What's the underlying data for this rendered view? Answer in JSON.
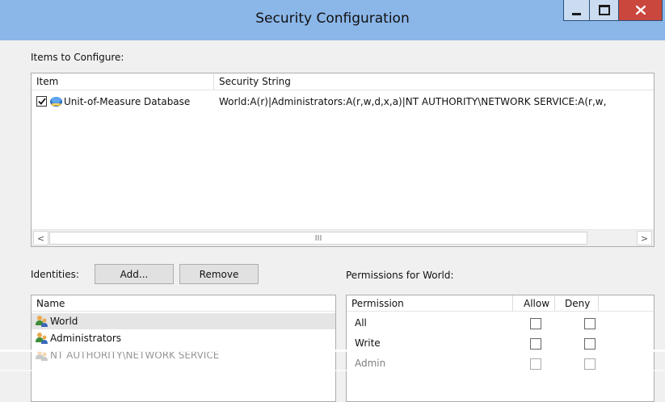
{
  "window": {
    "title": "Security Configuration",
    "controls": {
      "minimize": "minimize-icon",
      "maximize": "maximize-icon",
      "close": "close-icon"
    }
  },
  "items_section": {
    "label": "Items to Configure:",
    "columns": [
      "Item",
      "Security String"
    ],
    "rows": [
      {
        "checked": true,
        "icon": "database-icon",
        "item": "Unit-of-Measure Database",
        "security_string": "World:A(r)|Administrators:A(r,w,d,x,a)|NT AUTHORITY\\NETWORK SERVICE:A(r,w,"
      }
    ],
    "scrollbar": {
      "left_arrow": "<",
      "right_arrow": ">",
      "thumb_grip": "III"
    }
  },
  "identities": {
    "label": "Identities:",
    "add_button": "Add...",
    "remove_button": "Remove",
    "column": "Name",
    "items": [
      {
        "name": "World",
        "icon": "user-group-icon",
        "selected": true
      },
      {
        "name": "Administrators",
        "icon": "user-group-icon",
        "selected": false
      },
      {
        "name": "NT AUTHORITY\\NETWORK SERVICE",
        "icon": "user-group-icon",
        "selected": false
      }
    ]
  },
  "permissions": {
    "label": "Permissions for World:",
    "columns": [
      "Permission",
      "Allow",
      "Deny"
    ],
    "rows": [
      {
        "name": "All",
        "allow": false,
        "deny": false
      },
      {
        "name": "Write",
        "allow": false,
        "deny": false
      },
      {
        "name": "Admin",
        "allow": false,
        "deny": false
      }
    ]
  },
  "colors": {
    "titlebar": "#8bb6e8",
    "close_button": "#c9473d",
    "selection": "#e5e5e5"
  }
}
